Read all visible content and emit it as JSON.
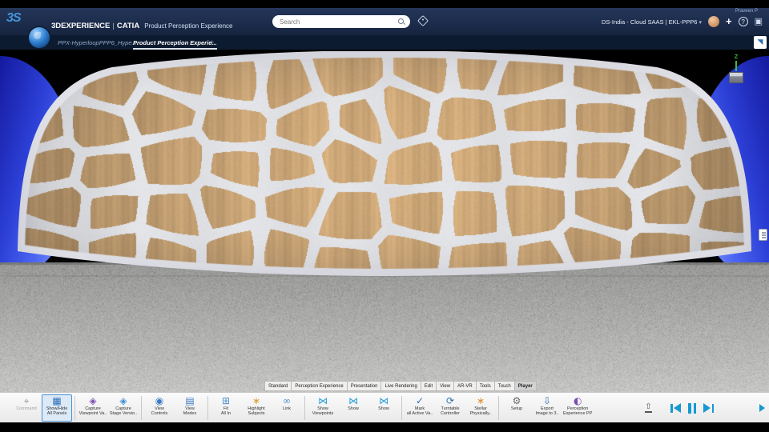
{
  "header": {
    "logo": "3S",
    "brand": "3DEXPERIENCE",
    "divider": "|",
    "app": "CATIA",
    "product": "Product Perception Experience",
    "search_placeholder": "Search",
    "user_name": "Praveen P",
    "tenant": "DS-India - Cloud SAAS | EKL-PPP6",
    "plus_label": "+",
    "help_label": "?"
  },
  "icons": {
    "caret_down": "▾",
    "share_window": "▣",
    "maximize": "◥"
  },
  "tabbar": {
    "document_tab": "PPX-HyperloopPPP6_Hype...",
    "active_tab": "Product Perception Experie...",
    "new_tab": "+"
  },
  "viewport": {
    "axis_z": "Z"
  },
  "ribbon": {
    "active": "Player",
    "tabs": [
      "Standard",
      "Perception Experience",
      "Presentation",
      "Live Rendering",
      "Edit",
      "View",
      "AR-VR",
      "Tools",
      "Touch",
      "Player"
    ]
  },
  "toolbar": {
    "buttons": [
      {
        "name": "command-button",
        "icon": "⌖",
        "color": "#9a9a9a",
        "l1": "Command",
        "l2": "",
        "disabled": true
      },
      {
        "name": "show-hide-all-panels-button",
        "icon": "▦",
        "color": "#2f6fb5",
        "l1": "Show/Hide",
        "l2": "All Panels",
        "selected": true
      },
      {
        "name": "capture-viewpoint-button",
        "icon": "◈",
        "color": "#7a4fb5",
        "l1": "Capture",
        "l2": "Viewpoint Va..",
        "sep_before": true
      },
      {
        "name": "capture-stage-button",
        "icon": "◈",
        "color": "#3f8fd4",
        "l1": "Capture",
        "l2": "Stage Versio.."
      },
      {
        "name": "view-controls-button",
        "icon": "◉",
        "color": "#3a7abf",
        "l1": "View",
        "l2": "Controls",
        "sep_before": true
      },
      {
        "name": "view-modes-button",
        "icon": "▤",
        "color": "#3a7abf",
        "l1": "View",
        "l2": "Modes"
      },
      {
        "name": "fit-all-in-button",
        "icon": "⊞",
        "color": "#4a8fd0",
        "l1": "Fit",
        "l2": "All In",
        "sep_before": true
      },
      {
        "name": "highlight-subjects-button",
        "icon": "∗",
        "color": "#d99a2b",
        "l1": "Highlight",
        "l2": "Subjects"
      },
      {
        "name": "link-button",
        "icon": "∞",
        "color": "#4a8fd0",
        "l1": "Link",
        "l2": ""
      },
      {
        "name": "show-viewpoints-button",
        "icon": "⋈",
        "color": "#29a0d8",
        "l1": "Show",
        "l2": "Viewpoints",
        "sep_before": true
      },
      {
        "name": "show-button-1",
        "icon": "⋈",
        "color": "#29a0d8",
        "l1": "Show",
        "l2": ""
      },
      {
        "name": "show-button-2",
        "icon": "⋈",
        "color": "#29a0d8",
        "l1": "Show",
        "l2": ""
      },
      {
        "name": "mark-all-active-button",
        "icon": "✓",
        "color": "#2f6fb5",
        "l1": "Mark",
        "l2": "all Active Va..",
        "sep_before": true
      },
      {
        "name": "turntable-controller-button",
        "icon": "⟳",
        "color": "#2f6fb5",
        "l1": "Turntable",
        "l2": "Controller"
      },
      {
        "name": "stellar-button",
        "icon": "∗",
        "color": "#e08a2a",
        "l1": "Stellar",
        "l2": "Physically.."
      },
      {
        "name": "setup-button",
        "icon": "⚙",
        "color": "#6b6b6b",
        "l1": "Setup",
        "l2": "",
        "sep_before": true
      },
      {
        "name": "export-image-button",
        "icon": "⇩",
        "color": "#2f6fb5",
        "l1": "Export",
        "l2": "Image to 3.."
      },
      {
        "name": "perception-experience-button",
        "icon": "◐",
        "color": "#7a4fb5",
        "l1": "Perception",
        "l2": "Experience PP"
      }
    ]
  }
}
